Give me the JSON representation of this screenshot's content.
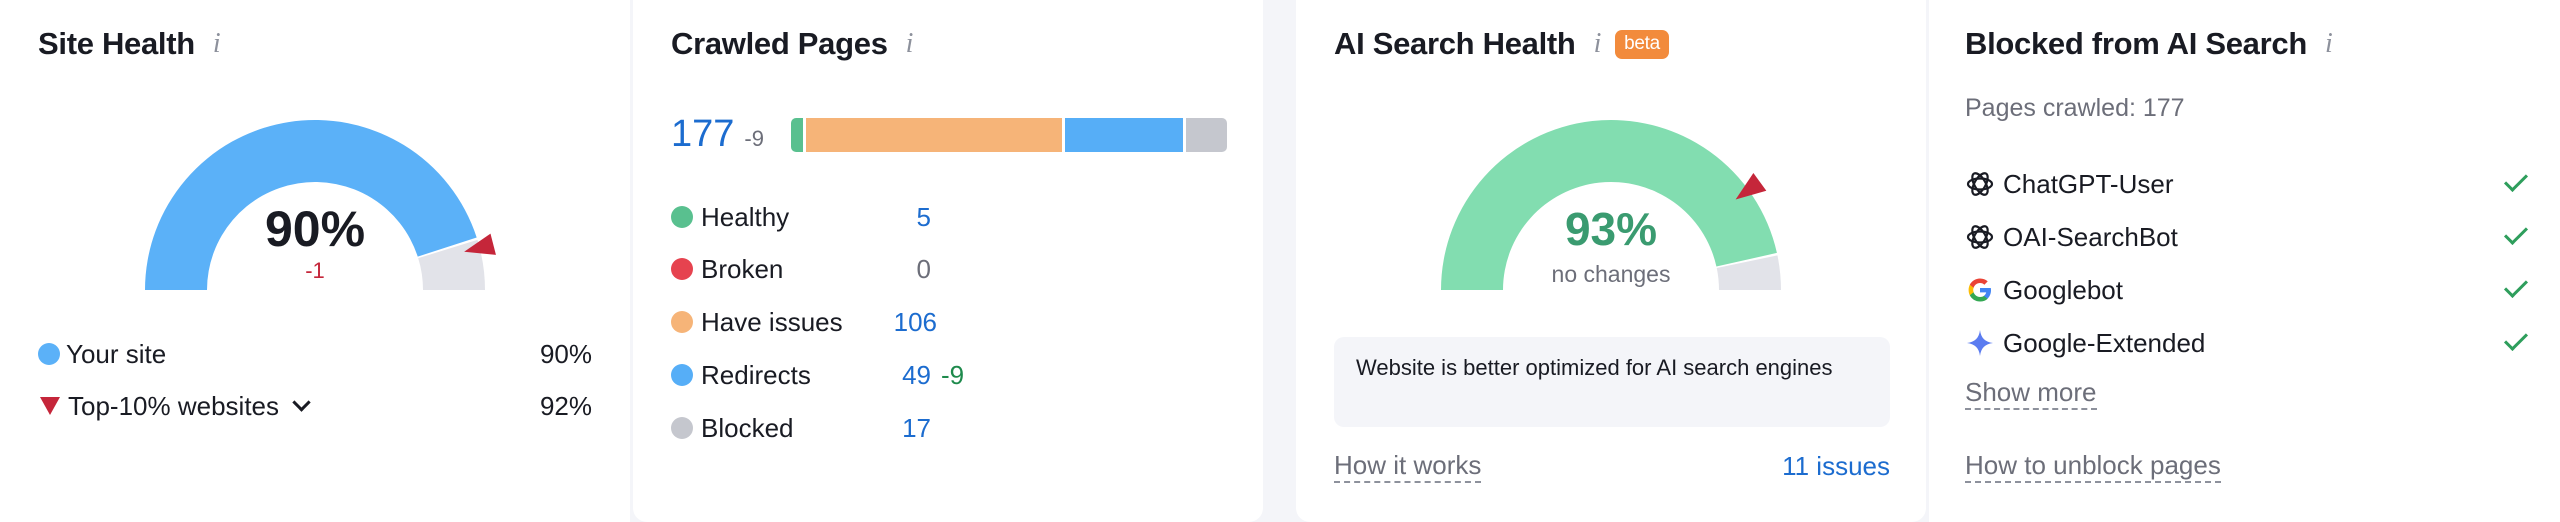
{
  "site_health": {
    "title": "Site Health",
    "value": "90%",
    "change": "-1",
    "score": 90,
    "top10_score": 92,
    "legend": [
      {
        "label": "Your site",
        "value": "90%"
      },
      {
        "label": "Top-10% websites",
        "value": "92%"
      }
    ]
  },
  "crawled_pages": {
    "title": "Crawled Pages",
    "total": "177",
    "change": "-9",
    "items": [
      {
        "label": "Healthy",
        "value": "5",
        "count": 5,
        "color": "#59c08f",
        "delta": ""
      },
      {
        "label": "Broken",
        "value": "0",
        "count": 0,
        "color": "#e6434f",
        "delta": ""
      },
      {
        "label": "Have issues",
        "value": "106",
        "count": 106,
        "color": "#f6b478",
        "delta": ""
      },
      {
        "label": "Redirects",
        "value": "49",
        "count": 49,
        "color": "#56aef7",
        "delta": "-9"
      },
      {
        "label": "Blocked",
        "value": "17",
        "count": 17,
        "color": "#c5c7ce",
        "delta": ""
      }
    ]
  },
  "ai_search_health": {
    "title": "AI Search Health",
    "badge": "beta",
    "value": "93%",
    "score": 93,
    "subtitle": "no changes",
    "note": "Website is better optimized for AI search engines",
    "how_it_works": "How it works",
    "issues": "11 issues"
  },
  "blocked_ai": {
    "title": "Blocked from AI Search",
    "pages_crawled": "Pages crawled: 177",
    "bots": [
      {
        "name": "ChatGPT-User",
        "icon": "openai-icon"
      },
      {
        "name": "OAI-SearchBot",
        "icon": "openai-icon"
      },
      {
        "name": "Googlebot",
        "icon": "google-icon"
      },
      {
        "name": "Google-Extended",
        "icon": "gemini-icon"
      }
    ],
    "show_more": "Show more",
    "unblock_link": "How to unblock pages"
  },
  "colors": {
    "site_gauge": "#5bb1f8",
    "ai_gauge": "#82ddb0",
    "gauge_track": "#e2e3e9",
    "marker": "#c5263a",
    "link": "#1c6ccf"
  }
}
